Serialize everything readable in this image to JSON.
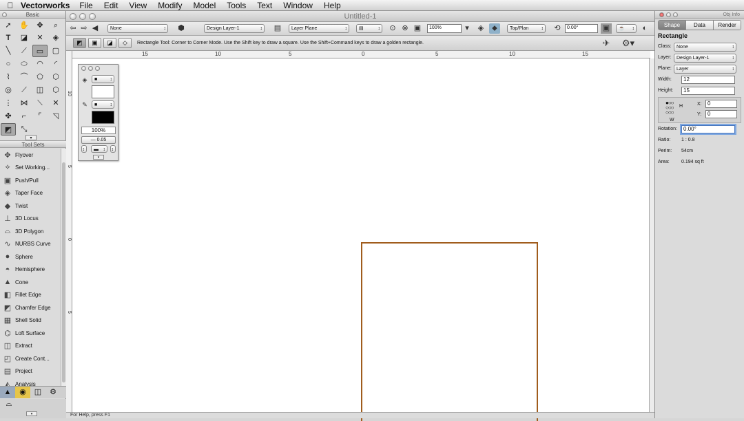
{
  "menubar": {
    "app": "Vectorworks",
    "items": [
      "File",
      "Edit",
      "View",
      "Modify",
      "Model",
      "Tools",
      "Text",
      "Window",
      "Help"
    ]
  },
  "window": {
    "title": "Untitled-1"
  },
  "toolbar": {
    "class_value": "None",
    "layer_value": "Design Layer-1",
    "plane_value": "Layer Plane",
    "zoom_value": "100%",
    "view_value": "Top/Plan",
    "angle_value": "0.00°"
  },
  "modebar": {
    "help_text": "Rectangle Tool: Corner to Corner Mode. Use the Shift key to draw a square. Use the Shift+Command keys to draw a golden rectangle."
  },
  "tool_palette": {
    "title": "Basic"
  },
  "tool_sets": {
    "title": "Tool Sets",
    "items": [
      {
        "label": "Flyover",
        "icon": "flyover-icon",
        "glyph": "✥"
      },
      {
        "label": "Set Working...",
        "icon": "working-plane-icon",
        "glyph": "⟡"
      },
      {
        "label": "Push/Pull",
        "icon": "push-pull-icon",
        "glyph": "▣"
      },
      {
        "label": "Taper Face",
        "icon": "taper-face-icon",
        "glyph": "◈"
      },
      {
        "label": "Twist",
        "icon": "twist-icon",
        "glyph": "◆"
      },
      {
        "label": "3D Locus",
        "icon": "locus-icon",
        "glyph": "⊥"
      },
      {
        "label": "3D Polygon",
        "icon": "polygon-3d-icon",
        "glyph": "⌓"
      },
      {
        "label": "NURBS Curve",
        "icon": "nurbs-icon",
        "glyph": "∿"
      },
      {
        "label": "Sphere",
        "icon": "sphere-icon",
        "glyph": "●"
      },
      {
        "label": "Hemisphere",
        "icon": "hemisphere-icon",
        "glyph": "◓"
      },
      {
        "label": "Cone",
        "icon": "cone-icon",
        "glyph": "▲"
      },
      {
        "label": "Fillet Edge",
        "icon": "fillet-edge-icon",
        "glyph": "◧"
      },
      {
        "label": "Chamfer Edge",
        "icon": "chamfer-edge-icon",
        "glyph": "◩"
      },
      {
        "label": "Shell Solid",
        "icon": "shell-solid-icon",
        "glyph": "▦"
      },
      {
        "label": "Loft Surface",
        "icon": "loft-surface-icon",
        "glyph": "⌬"
      },
      {
        "label": "Extract",
        "icon": "extract-icon",
        "glyph": "◫"
      },
      {
        "label": "Create Cont...",
        "icon": "contour-icon",
        "glyph": "◰"
      },
      {
        "label": "Project",
        "icon": "project-icon",
        "glyph": "▤"
      },
      {
        "label": "Analysis",
        "icon": "analysis-icon",
        "glyph": "◭"
      }
    ]
  },
  "rulers": {
    "h_ticks": [
      "15",
      "10",
      "5",
      "0",
      "5",
      "10",
      "15"
    ],
    "v_ticks": [
      "10",
      "5",
      "0",
      "5"
    ]
  },
  "attributes": {
    "opacity": "100%",
    "line_weight": "0.05"
  },
  "status": {
    "text": "For Help, press F1"
  },
  "obj_info": {
    "title": "Obj Info",
    "tabs": [
      "Shape",
      "Data",
      "Render"
    ],
    "object_type": "Rectangle",
    "class_label": "Class:",
    "class_value": "None",
    "layer_label": "Layer:",
    "layer_value": "Design Layer-1",
    "plane_label": "Plane:",
    "plane_value": "Layer",
    "width_label": "Width:",
    "width_value": "12",
    "height_label": "Height:",
    "height_value": "15",
    "x_label": "X:",
    "x_value": "0",
    "y_label": "Y:",
    "y_value": "0",
    "w_label": "W",
    "h_label": "H",
    "rotation_label": "Rotation:",
    "rotation_value": "0.00°",
    "ratio_label": "Ratio:",
    "ratio_value": "1 : 0.8",
    "perim_label": "Perim:",
    "perim_value": "54cm",
    "area_label": "Area:",
    "area_value": "0.194 sq ft"
  },
  "colors": {
    "rectangle_stroke": "#a05c1c",
    "selection": "#7fa8e0"
  }
}
